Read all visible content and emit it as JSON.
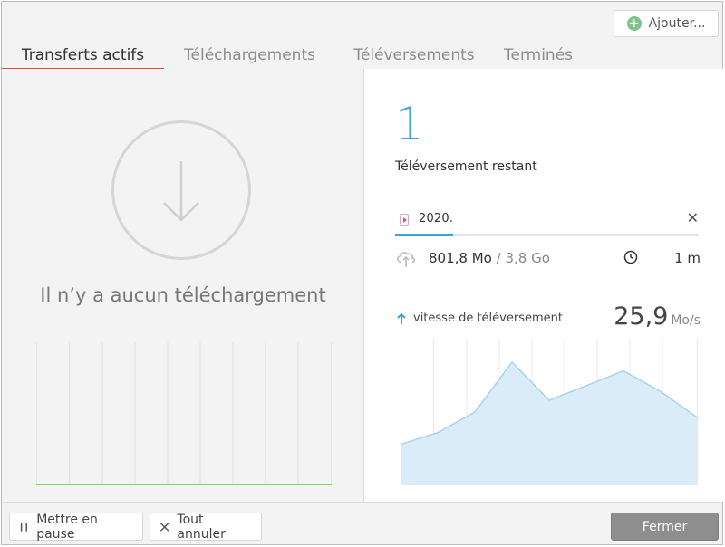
{
  "header": {
    "add_button_label": "Ajouter...",
    "tabs": [
      {
        "label": "Transferts actifs",
        "active": true
      },
      {
        "label": "Téléchargements",
        "active": false
      },
      {
        "label": "Téléversements",
        "active": false
      },
      {
        "label": "Terminés",
        "active": false
      }
    ]
  },
  "left_panel": {
    "empty_icon": "download-arrow-icon",
    "empty_message": "Il n’y a aucun téléchargement"
  },
  "right_panel": {
    "remaining_count": "1",
    "remaining_label": "Téléversement restant",
    "file": {
      "name": "2020.",
      "progress_fraction": 0.19
    },
    "transferred": "801,8 Mo",
    "total": "/ 3,8 Go",
    "eta": "1 m",
    "speed_label": "vitesse de téléversement",
    "speed_value": "25,9",
    "speed_unit": "Mo/s",
    "speed_history": [
      14,
      18,
      25,
      42,
      29,
      34,
      39,
      32,
      23
    ]
  },
  "footer": {
    "pause_label": "Mettre en pause",
    "cancel_all_label": "Tout annuler",
    "close_label": "Fermer"
  },
  "colors": {
    "accent_blue": "#3aa3dc",
    "active_tab_underline": "#e0464b",
    "idle_line": "#8dd07a",
    "speed_fill": "#d9ecf7"
  }
}
